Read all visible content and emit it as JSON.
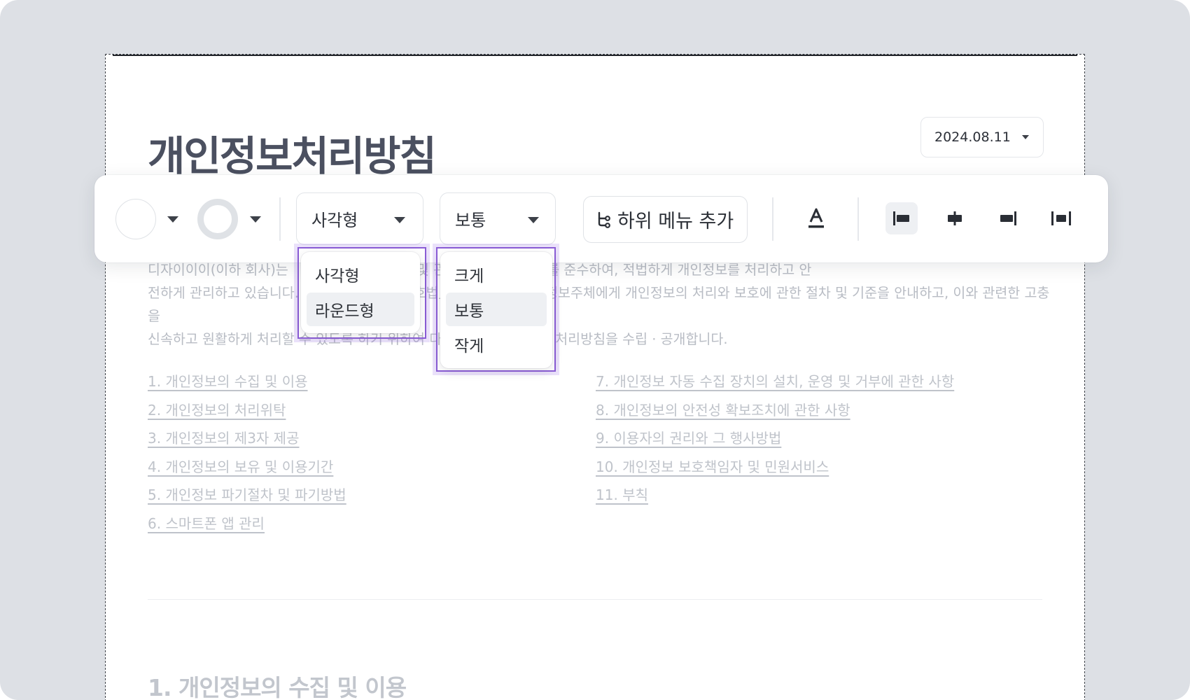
{
  "page": {
    "title": "개인정보처리방침",
    "date_select": {
      "value": "2024.08.11"
    },
    "intro_lines": [
      "디자이이이(이하 회사)는 「개인정보 보호법」 및 관계 법령이 정한 바를 준수하여, 적법하게 개인정보를 처리하고 안",
      "전하게 관리하고 있습니다. 이에 「개인정보 보호법」 제30조에 따라 정보주체에게 개인정보의 처리와 보호에 관한 절차 및 기준을 안내하고, 이와 관련한 고충을",
      "신속하고 원활하게 처리할 수 있도록 하기 위하여 다음과 같이 개인정보 처리방침을 수립 · 공개합니다."
    ],
    "toc_left": [
      "1. 개인정보의 수집 및 이용",
      "2. 개인정보의 처리위탁",
      "3. 개인정보의 제3자 제공",
      "4. 개인정보의 보유 및 이용기간",
      "5. 개인정보 파기절차 및 파기방법",
      "6. 스마트폰 앱 관리"
    ],
    "toc_right": [
      "7. 개인정보 자동 수집 장치의 설치, 운영 및 거부에 관한 사항",
      "8. 개인정보의 안전성 확보조치에 관한 사항",
      "9. 이용자의 권리와 그 행사방법",
      "10. 개인정보 보호책임자 및 민원서비스",
      "11. 부칙"
    ],
    "section_title": "1. 개인정보의 수집 및 이용"
  },
  "toolbar": {
    "fill_color_icon": "circle-solid-icon",
    "border_style_icon": "circle-ring-icon",
    "shape_select": {
      "value": "사각형"
    },
    "size_select": {
      "value": "보통"
    },
    "add_submenu_label": "하위 메뉴 추가",
    "add_submenu_icon": "branch-icon",
    "text_color_icon": "text-color-icon",
    "align_buttons": [
      "align-left-icon",
      "align-center-icon",
      "align-right-icon",
      "align-justify-icon"
    ]
  },
  "dropdowns": {
    "shape_options": [
      "사각형",
      "라운드형"
    ],
    "shape_selected": "라운드형",
    "size_options": [
      "크게",
      "보통",
      "작게"
    ],
    "size_selected": "보통"
  },
  "colors": {
    "accent": "#8a5cd6",
    "title": "#4b5060",
    "background": "#dde0e5"
  }
}
